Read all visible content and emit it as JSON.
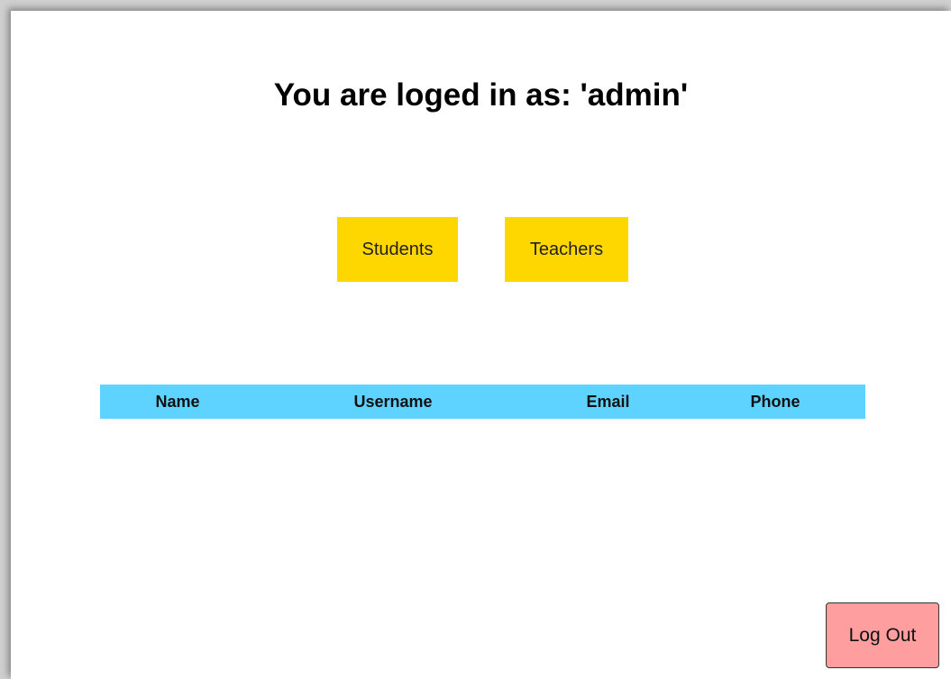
{
  "header": {
    "title": "You are loged in as: 'admin'"
  },
  "nav": {
    "students_label": "Students",
    "teachers_label": "Teachers"
  },
  "table": {
    "columns": [
      "Name",
      "Username",
      "Email",
      "Phone"
    ],
    "rows": []
  },
  "footer": {
    "logout_label": "Log Out"
  },
  "colors": {
    "nav_button_bg": "#FFD700",
    "table_header_bg": "#5FD3FF",
    "logout_bg": "#FF9E9E"
  }
}
